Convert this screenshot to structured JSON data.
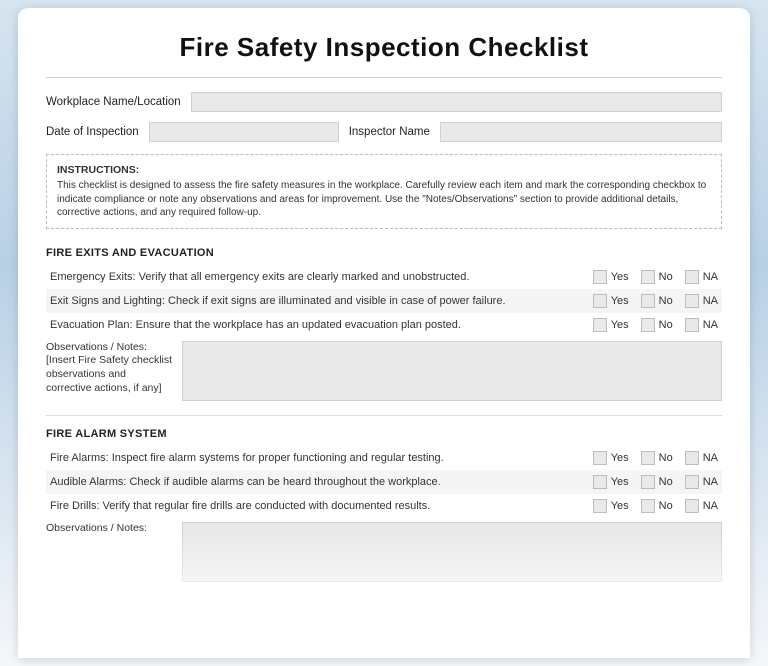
{
  "title": "Fire Safety Inspection Checklist",
  "header": {
    "workplace_label": "Workplace Name/Location",
    "date_label": "Date of Inspection",
    "inspector_label": "Inspector Name"
  },
  "instructions": {
    "title": "INSTRUCTIONS:",
    "body": "This checklist is designed to assess the fire safety measures in the workplace. Carefully review each item and mark the corresponding checkbox to indicate compliance or note any observations and areas for improvement. Use the \"Notes/Observations\" section to provide additional details, corrective actions, and any required follow-up."
  },
  "options": {
    "yes": "Yes",
    "no": "No",
    "na": "NA"
  },
  "section1": {
    "title": "FIRE EXITS AND EVACUATION",
    "items": [
      "Emergency Exits: Verify that all emergency exits are clearly marked and unobstructed.",
      "Exit Signs and Lighting: Check if exit signs are illuminated and visible in case of power failure.",
      "Evacuation Plan: Ensure that the workplace has an updated evacuation plan posted."
    ],
    "notes_label": "Observations / Notes: [Insert Fire Safety checklist observations and corrective actions, if any]"
  },
  "section2": {
    "title": "FIRE ALARM SYSTEM",
    "items": [
      "Fire Alarms: Inspect fire alarm systems for proper functioning and regular testing.",
      "Audible Alarms: Check if audible alarms can be heard throughout the workplace.",
      "Fire Drills: Verify that regular fire drills are conducted with documented results."
    ],
    "notes_label": "Observations / Notes:"
  }
}
